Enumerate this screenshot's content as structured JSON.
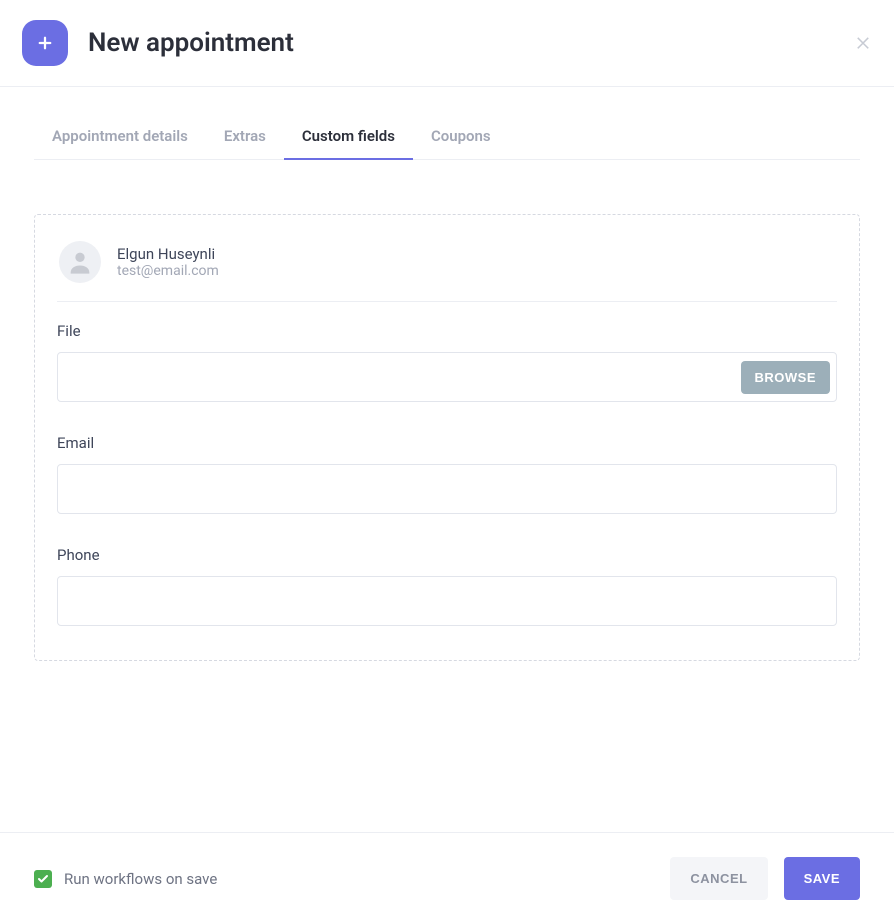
{
  "header": {
    "title": "New appointment"
  },
  "tabs": [
    {
      "label": "Appointment details",
      "active": false
    },
    {
      "label": "Extras",
      "active": false
    },
    {
      "label": "Custom fields",
      "active": true
    },
    {
      "label": "Coupons",
      "active": false
    }
  ],
  "user": {
    "name": "Elgun Huseynli",
    "email": "test@email.com"
  },
  "fields": {
    "file": {
      "label": "File",
      "browse_label": "BROWSE",
      "value": ""
    },
    "email": {
      "label": "Email",
      "value": ""
    },
    "phone": {
      "label": "Phone",
      "value": ""
    }
  },
  "footer": {
    "workflow_label": "Run workflows on save",
    "workflow_checked": true,
    "cancel_label": "CANCEL",
    "save_label": "SAVE"
  }
}
